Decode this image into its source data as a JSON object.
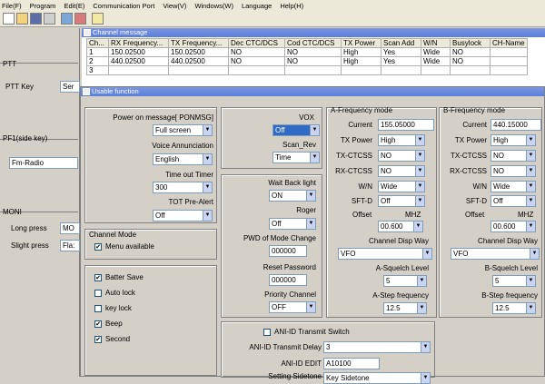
{
  "menu": [
    "File(F)",
    "Program",
    "Edit(E)",
    "Communication Port",
    "View(V)",
    "Windows(W)",
    "Language",
    "Help(H)"
  ],
  "left": {
    "ptt_heading": "PTT",
    "ptt_key_label": "PTT Key",
    "ptt_key_value": "Ser",
    "pf1_heading": "PF1(side key)",
    "pf1_value": "Fm-Radio",
    "moni_heading": "MONI",
    "long_press_label": "Long press",
    "long_press_value": "MO",
    "slight_press_label": "Slight press",
    "slight_press_value": "Fla:"
  },
  "channel": {
    "title": "Channel message",
    "headers": [
      "Ch...",
      "RX Frequency...",
      "TX Frequency...",
      "Dec CTC/DCS",
      "Cod CTC/DCS",
      "TX Power",
      "Scan Add",
      "W/N",
      "Busylock",
      "CH-Name"
    ],
    "rows": [
      [
        "1",
        "150.02500",
        "150.02500",
        "NO",
        "NO",
        "High",
        "Yes",
        "Wide",
        "NO",
        ""
      ],
      [
        "2",
        "440.02500",
        "440.02500",
        "NO",
        "NO",
        "High",
        "Yes",
        "Wide",
        "NO",
        ""
      ],
      [
        "3",
        "",
        "",
        "",
        "",
        "",
        "",
        "",
        "",
        ""
      ]
    ]
  },
  "usable": {
    "title": "Usable function",
    "power_on_label": "Power on message[ PONMSG]",
    "power_on_value": "Full screen",
    "voice_label": "Voice Annunciation",
    "voice_value": "English",
    "timeout_label": "Time out Timer",
    "timeout_value": "300",
    "tot_label": "TOT Pre-Alert",
    "tot_value": "Off",
    "channel_mode_label": "Channel Mode",
    "menu_available": "Menu available",
    "batter_save": "Batter Save",
    "auto_lock": "Auto lock",
    "key_lock": "key lock",
    "beep": "Beep",
    "second": "Second",
    "vox_label": "VOX",
    "vox_value": "Off",
    "scan_rev_label": "Scan_Rev",
    "scan_rev_value": "Time",
    "wait_backlight_label": "Wait Back light",
    "wait_backlight_value": "ON",
    "roger_label": "Roger",
    "roger_value": "Off",
    "pwd_label": "PWD of Mode Change",
    "pwd_value": "000000",
    "reset_label": "Reset Password",
    "reset_value": "000000",
    "priority_label": "Priority Channel",
    "priority_value": "OFF",
    "ani_switch": "ANI-ID Transmit Switch",
    "ani_delay_label": "ANI-ID  Transmit Delay",
    "ani_delay_value": "3",
    "ani_edit_label": "ANI-ID EDIT",
    "ani_edit_value": "A10100",
    "sidetone_label": "Setting Sidetone",
    "sidetone_value": "Key Sidetone",
    "afreq": {
      "title": "A-Frequency mode",
      "current_label": "Current",
      "current_value": "155.05000",
      "txpower_label": "TX Power",
      "txpower_value": "High",
      "txctcss_label": "TX-CTCSS",
      "txctcss_value": "NO",
      "rxctcss_label": "RX-CTCSS",
      "rxctcss_value": "NO",
      "wn_label": "W/N",
      "wn_value": "Wide",
      "sftd_label": "SFT-D",
      "sftd_value": "Off",
      "offset_label": "Offset",
      "mhz_label": "MHZ",
      "offset_value": "00.600",
      "disp_label": "Channel Disp Way",
      "disp_value": "VFO",
      "squelch_label": "A-Squelch Level",
      "squelch_value": "5",
      "step_label": "A-Step frequency",
      "step_value": "12.5"
    },
    "bfreq": {
      "title": "B-Frequency mode",
      "current_label": "Current",
      "current_value": "440.15000",
      "txpower_label": "TX Power",
      "txpower_value": "High",
      "txctcss_label": "TX-CTCSS",
      "txctcss_value": "NO",
      "rxctcss_label": "RX-CTCSS",
      "rxctcss_value": "NO",
      "wn_label": "W/N",
      "wn_value": "Wide",
      "sftd_label": "SFT-D",
      "sftd_value": "Off",
      "offset_label": "Offset",
      "mhz_label": "MHZ",
      "offset_value": "00.600",
      "disp_label": "Channel Disp Way",
      "disp_value": "VFO",
      "squelch_label": "B-Squelch Level",
      "squelch_value": "5",
      "step_label": "B-Step frequency",
      "step_value": "12.5"
    }
  }
}
